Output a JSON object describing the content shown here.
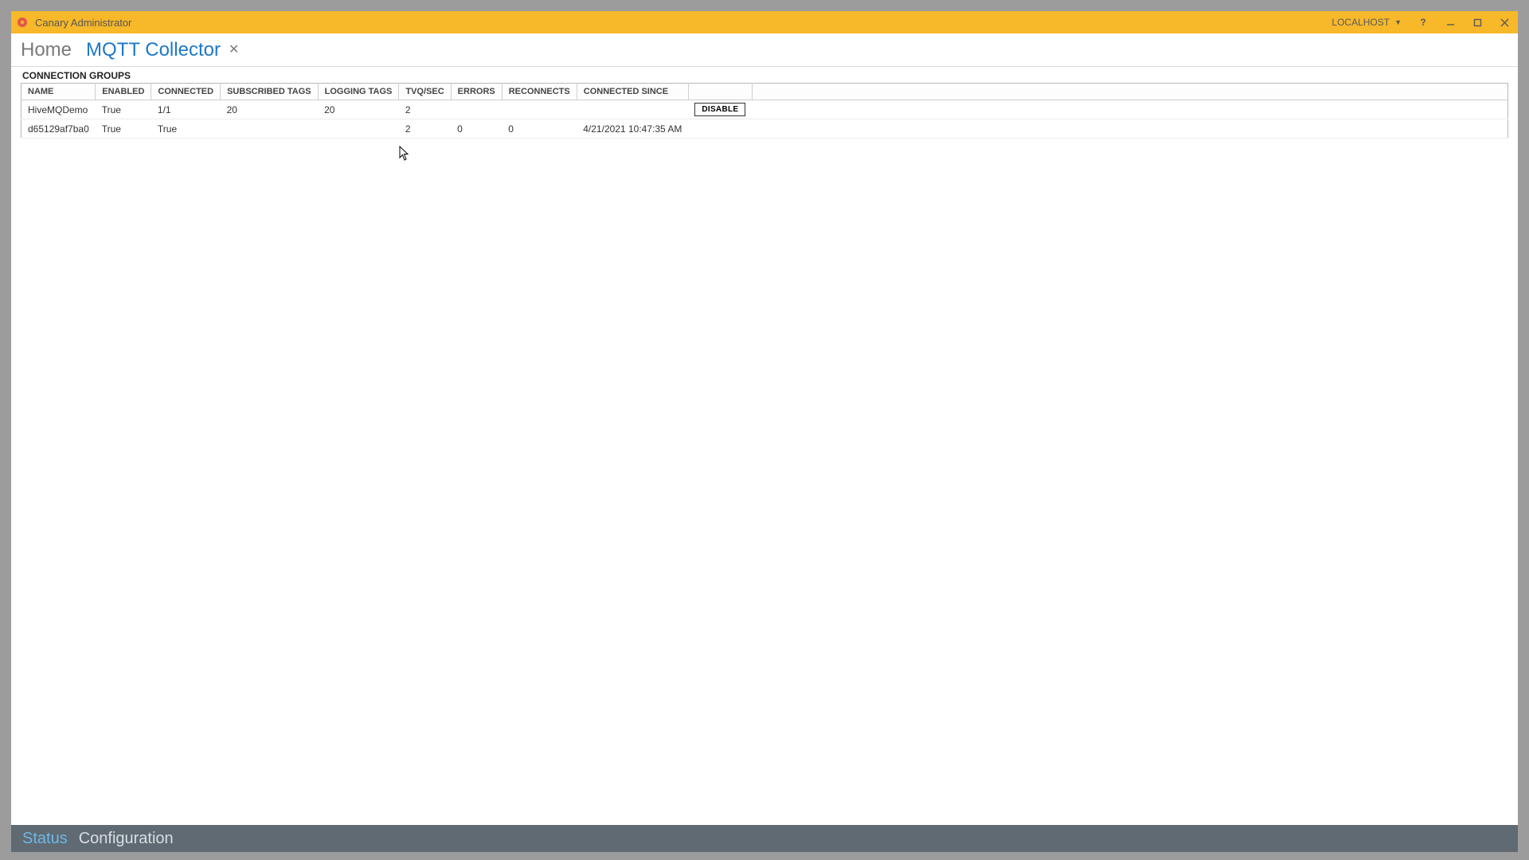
{
  "window": {
    "title": "Canary Administrator",
    "host_label": "LOCALHOST"
  },
  "crumbs": {
    "home": "Home",
    "active_tab": "MQTT Collector"
  },
  "section_heading": "CONNECTION GROUPS",
  "columns": {
    "name": "NAME",
    "enabled": "ENABLED",
    "connected": "CONNECTED",
    "subscribed": "SUBSCRIBED TAGS",
    "logging": "LOGGING TAGS",
    "tvq": "TVQ/SEC",
    "errors": "ERRORS",
    "reconnects": "RECONNECTS",
    "since": "CONNECTED SINCE"
  },
  "rows": [
    {
      "name": "HiveMQDemo",
      "enabled": "True",
      "connected": "1/1",
      "subscribed": "20",
      "logging": "20",
      "tvq": "2",
      "errors": "",
      "reconnects": "",
      "since": "",
      "action": "DISABLE",
      "selected": true
    },
    {
      "name": "d65129af7ba0",
      "enabled": "True",
      "connected": "True",
      "subscribed": "",
      "logging": "",
      "tvq": "2",
      "errors": "0",
      "reconnects": "0",
      "since": "4/21/2021 10:47:35 AM",
      "action": "",
      "selected": false
    }
  ],
  "footer": {
    "status": "Status",
    "configuration": "Configuration"
  }
}
